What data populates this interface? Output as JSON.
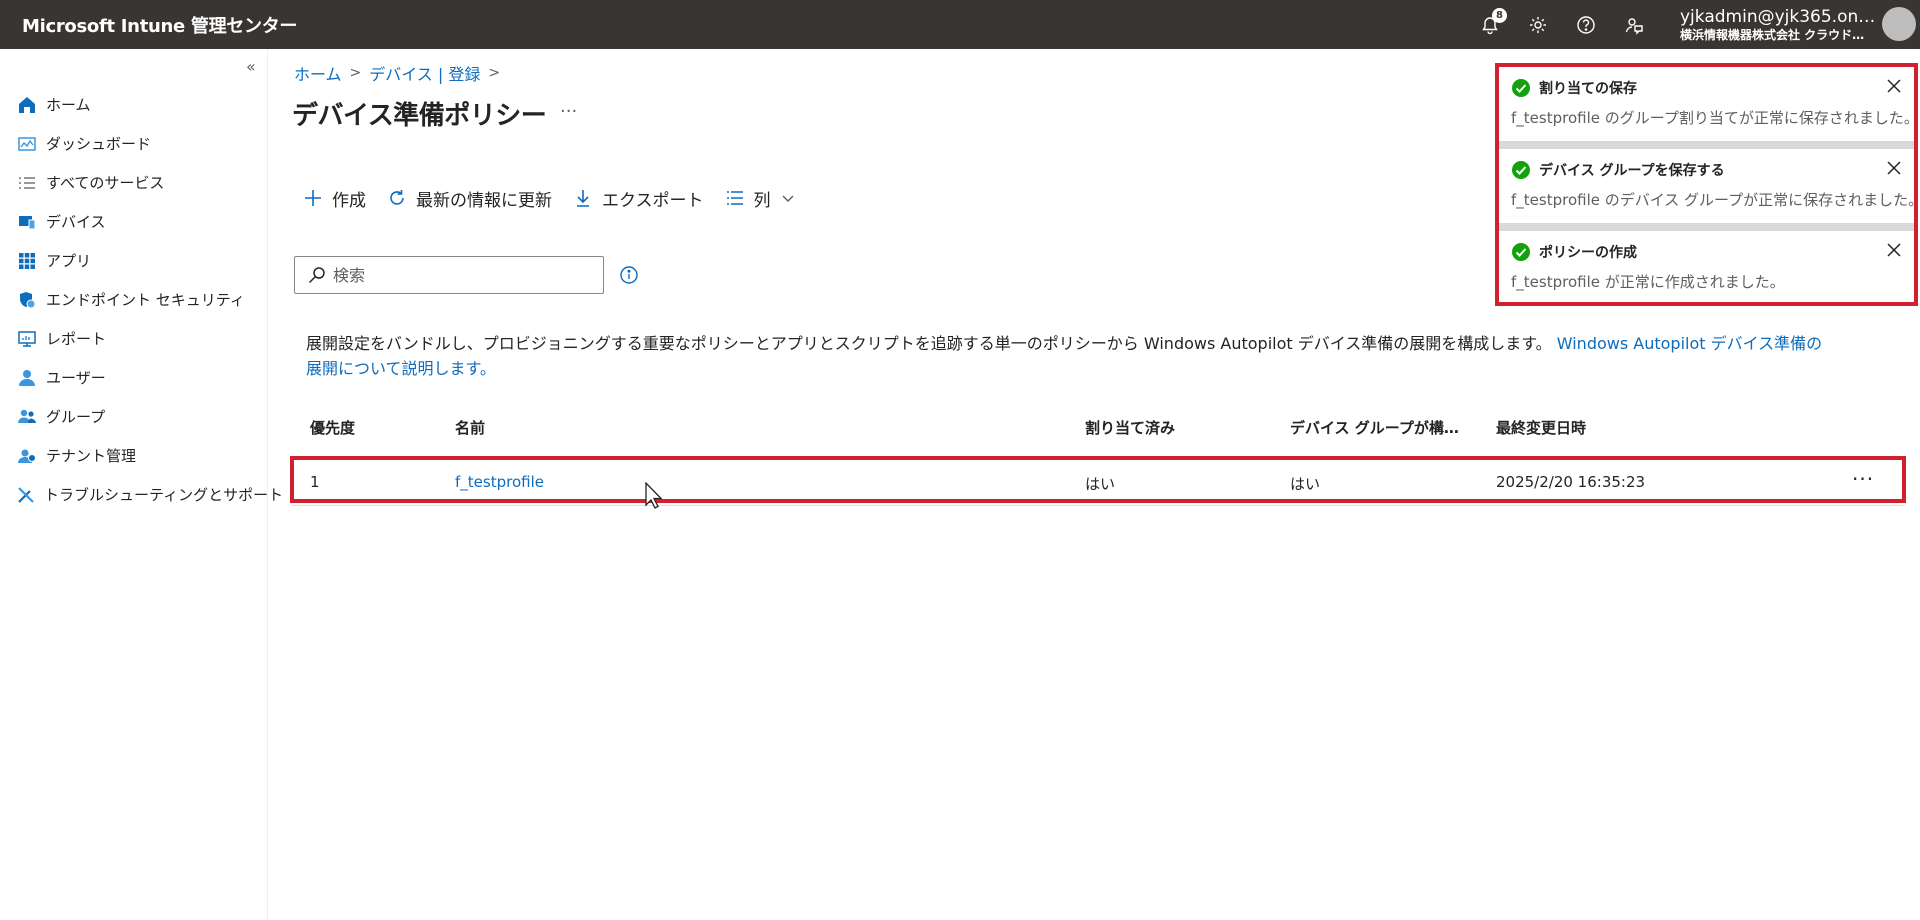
{
  "app": {
    "title": "Microsoft Intune 管理センター"
  },
  "header": {
    "notification_count": "8",
    "icons": [
      "bell-icon",
      "gear-icon",
      "help-icon",
      "feedback-icon"
    ],
    "account_email": "yjkadmin@yjk365.on…",
    "account_org": "横浜情報機器株式会社 クラウド…"
  },
  "sidebar": {
    "collapse_label": "«",
    "items": [
      {
        "label": "ホーム",
        "icon": "home-icon"
      },
      {
        "label": "ダッシュボード",
        "icon": "dashboard-icon"
      },
      {
        "label": "すべてのサービス",
        "icon": "list-icon"
      },
      {
        "label": "デバイス",
        "icon": "devices-icon"
      },
      {
        "label": "アプリ",
        "icon": "apps-icon"
      },
      {
        "label": "エンドポイント セキュリティ",
        "icon": "shield-icon"
      },
      {
        "label": "レポート",
        "icon": "reports-icon"
      },
      {
        "label": "ユーザー",
        "icon": "user-icon"
      },
      {
        "label": "グループ",
        "icon": "group-icon"
      },
      {
        "label": "テナント管理",
        "icon": "tenant-icon"
      },
      {
        "label": "トラブルシューティングとサポート",
        "icon": "tools-icon"
      }
    ]
  },
  "breadcrumb": {
    "items": [
      "ホーム",
      "デバイス | 登録"
    ],
    "sep": ">"
  },
  "page": {
    "title": "デバイス準備ポリシー",
    "more": "···"
  },
  "toolbar": {
    "create_label": "作成",
    "refresh_label": "最新の情報に更新",
    "export_label": "エクスポート",
    "columns_label": "列"
  },
  "search": {
    "placeholder": "検索",
    "value": ""
  },
  "description": {
    "text": "展開設定をバンドルし、プロビジョニングする重要なポリシーとアプリとスクリプトを追跡する単一のポリシーから Windows Autopilot デバイス準備の展開を構成します。",
    "link_line1": "Windows Autopilot デバイス準備の",
    "link_line2": "展開について説明します。"
  },
  "table": {
    "columns": [
      "優先度",
      "名前",
      "割り当て済み",
      "デバイス グループが構…",
      "最終変更日時"
    ],
    "rows": [
      {
        "priority": "1",
        "name": "f_testprofile",
        "assigned": "はい",
        "device_group": "はい",
        "modified": "2025/2/20 16:35:23",
        "more": "···"
      }
    ]
  },
  "toasts": [
    {
      "title": "割り当ての保存",
      "body": "f_testprofile のグループ割り当てが正常に保存されました。"
    },
    {
      "title": "デバイス グループを保存する",
      "body": "f_testprofile のデバイス グループが正常に保存されました。"
    },
    {
      "title": "ポリシーの作成",
      "body": "f_testprofile が正常に作成されました。"
    }
  ],
  "colors": {
    "topbar": "#393533",
    "accent": "#0f6cbd",
    "success": "#13a10e",
    "highlight": "#d1202f"
  }
}
